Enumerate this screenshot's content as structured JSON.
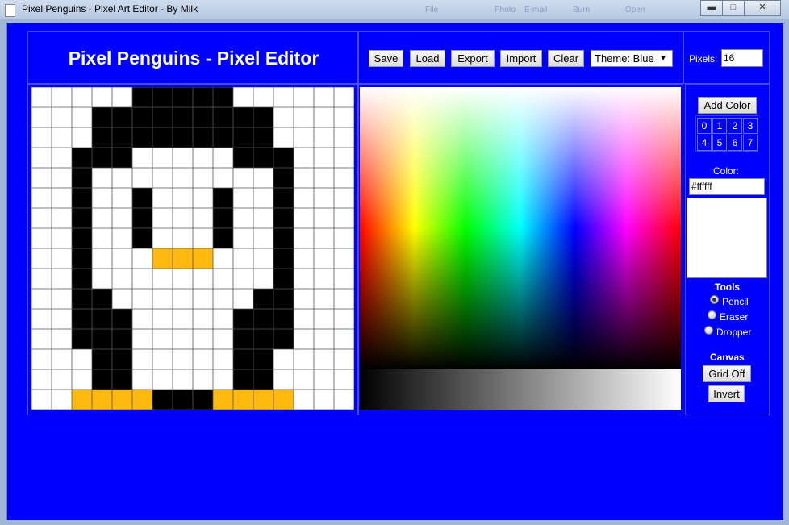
{
  "window": {
    "title": "Pixel Penguins - Pixel Art Editor - By Milk",
    "ghost_menu": [
      "File",
      "Photo",
      "E-mail",
      "Burn",
      "Open"
    ],
    "controls": [
      "minimize-icon",
      "maximize-icon",
      "close-icon"
    ]
  },
  "header": {
    "title": "Pixel Penguins - Pixel Editor"
  },
  "toolbar": {
    "save": "Save",
    "load": "Load",
    "export": "Export",
    "import": "Import",
    "clear": "Clear",
    "theme": "Theme: Blue"
  },
  "pixels": {
    "label": "Pixels:",
    "value": "16"
  },
  "side": {
    "add_color": "Add Color",
    "slots": [
      "0",
      "1",
      "2",
      "3",
      "4",
      "5",
      "6",
      "7"
    ],
    "color_label": "Color:",
    "color_value": "#ffffff",
    "tools_title": "Tools",
    "tools": [
      {
        "label": "Pencil",
        "selected": true
      },
      {
        "label": "Eraser",
        "selected": false
      },
      {
        "label": "Dropper",
        "selected": false
      }
    ],
    "canvas_title": "Canvas",
    "grid_off": "Grid Off",
    "invert": "Invert"
  },
  "colors": {
    "background": "#0000ff",
    "black": "#000000",
    "white": "#ffffff",
    "orange": "#ffb90f"
  },
  "pixel_art": {
    "size": 16,
    "palette": {
      "W": "#ffffff",
      "B": "#000000",
      "O": "#ffb90f"
    },
    "rows": [
      "WWWWWBBBBBWWWWWW",
      "WWWBBBBBBBBBWWWW",
      "WWWBBBBBBBBBWWWW",
      "WWBBBWWWWWBBBWWW",
      "WWBWWWWWWWWWBWWW",
      "WWBWWBWWWBWWBWWW",
      "WWBWWBWWWBWWBWWW",
      "WWBWWBWWWBWWBWWW",
      "WWBWWWOOOWWWBWWW",
      "WWBWWWWWWWWWBWWW",
      "WWBBWWWWWWWBBWWW",
      "WWBBBWWWWWBBBWWW",
      "WWBBBWWWWWBBBWWW",
      "WWWBBWWWWWBBWWWW",
      "WWWBBWWWWWBBWWWW",
      "WWOOOOBBBOOOOWWW"
    ]
  }
}
